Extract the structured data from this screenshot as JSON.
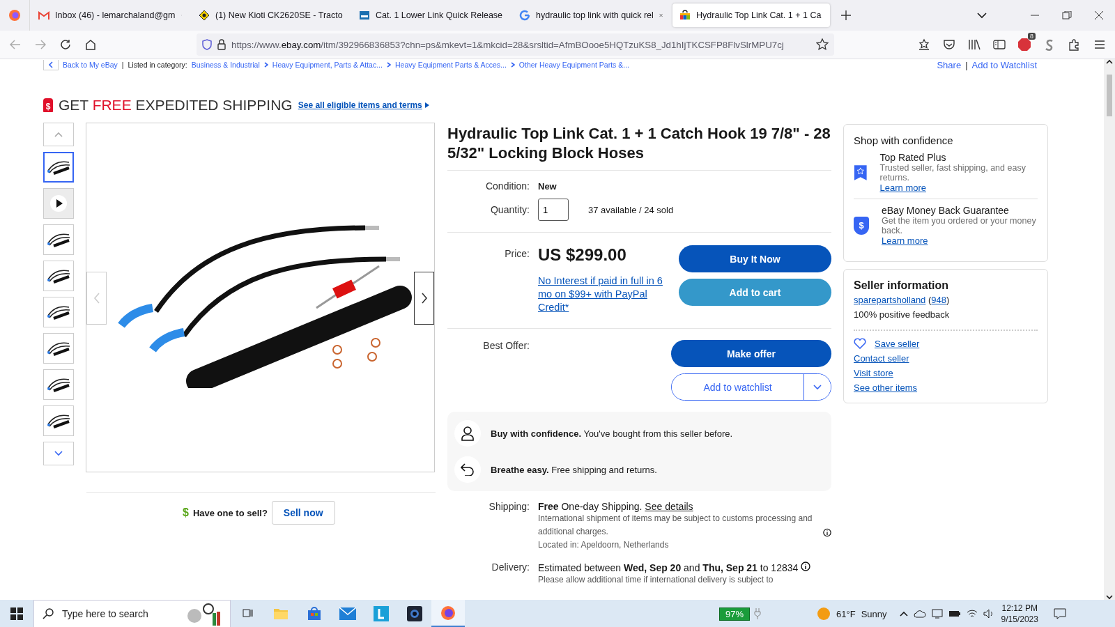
{
  "browser": {
    "tabs": [
      {
        "kind": "mail",
        "title": "Inbox (46) - lemarchaland@gm",
        "selected": false
      },
      {
        "kind": "sign",
        "title": "(1) New Kioti CK2620SE - Tracto",
        "selected": false
      },
      {
        "kind": "store",
        "title": "Cat. 1 Lower Link Quick Release",
        "selected": false
      },
      {
        "kind": "google",
        "title": "hydraulic top link with quick rel",
        "selected": false
      },
      {
        "kind": "bag",
        "title": "Hydraulic Top Link Cat. 1 + 1 Ca",
        "selected": true
      }
    ],
    "url": "https://www.ebay.com/itm/392966836853?chn=ps&mkevt=1&mkcid=28&srsltid=AfmBOooe5HQTzuKS8_Jd1hIjTKCSFP8FlvSlrMPU7cj",
    "adblock_count": "8"
  },
  "breadcrumb": {
    "back": "Back to My eBay",
    "label": "Listed in category:",
    "separator": "|",
    "crumbs": [
      "Business & Industrial",
      "Heavy Equipment, Parts & Attac...",
      "Heavy Equipment Parts & Acces...",
      "Other Heavy Equipment Parts &..."
    ],
    "share": "Share",
    "watch": "Add to Watchlist"
  },
  "banner": {
    "symbol": "$",
    "parts": [
      {
        "text": "GET ",
        "highlight": false
      },
      {
        "text": "FREE",
        "highlight": true
      },
      {
        "text": " EXPEDITED SHIPPING",
        "highlight": false
      }
    ],
    "link": "See all eligible items and terms"
  },
  "gallery": {
    "thumbnails": [
      {
        "kind": "photo",
        "selected": true
      },
      {
        "kind": "video",
        "selected": false
      },
      {
        "kind": "photo",
        "selected": false
      },
      {
        "kind": "photo",
        "selected": false
      },
      {
        "kind": "photo",
        "selected": false
      },
      {
        "kind": "photo",
        "selected": false
      },
      {
        "kind": "photo",
        "selected": false
      },
      {
        "kind": "photo",
        "selected": false
      }
    ]
  },
  "sell": {
    "symbol": "$",
    "prompt": "Have one to sell?",
    "button": "Sell now"
  },
  "item": {
    "title": "Hydraulic Top Link Cat. 1 + 1 Catch Hook 19 7/8\" - 28 5/32\" Locking Block Hoses",
    "condition_label": "Condition:",
    "condition": "New",
    "quantity_label": "Quantity:",
    "quantity": "1",
    "availability": "37 available / 24 sold",
    "price_label": "Price:",
    "price": "US $299.00",
    "financing": "No Interest if paid in full in 6 mo on $99+ with PayPal Credit*",
    "buy_now": "Buy It Now",
    "add_to_cart": "Add to cart",
    "best_offer_label": "Best Offer:",
    "make_offer": "Make offer",
    "watchlist": "Add to watchlist",
    "assurances": [
      {
        "kind": "person",
        "text": "**Buy with confidence.** You've bought from this seller before."
      },
      {
        "kind": "return",
        "text": "**Breathe easy.** Free shipping and returns."
      }
    ],
    "shipping_label": "Shipping:",
    "shipping": "**Free** One-day Shipping.",
    "shipping_link": "See details",
    "shipping_note": "International shipment of items may be subject to customs processing and additional charges.",
    "location": "Located in: Apeldoorn, Netherlands",
    "delivery_label": "Delivery:",
    "delivery": "Estimated between **Wed, Sep 20** and **Thu, Sep 21** to 12834",
    "delivery_note": "Please allow additional time if international delivery is subject to"
  },
  "confidence": {
    "title": "Shop with confidence",
    "items": [
      {
        "kind": "ribbon",
        "title": "Top Rated Plus",
        "text": "Trusted seller, fast shipping, and easy returns.",
        "link": "Learn more"
      },
      {
        "kind": "shield",
        "symbol": "$",
        "title": "eBay Money Back Guarantee",
        "text": "Get the item you ordered or your money back.",
        "link": "Learn more"
      }
    ]
  },
  "seller": {
    "title": "Seller information",
    "name": "sparepartsholland",
    "score": "(948)",
    "feedback": "100% positive feedback",
    "links": [
      {
        "kind": "heart",
        "text": "Save seller"
      },
      {
        "kind": "plain",
        "text": "Contact seller"
      },
      {
        "kind": "plain",
        "text": "Visit store"
      },
      {
        "kind": "plain",
        "text": "See other items"
      }
    ]
  },
  "taskbar": {
    "search_placeholder": "Type here to search",
    "apps": [
      {
        "kind": "taskview",
        "selected": false
      },
      {
        "kind": "folder",
        "selected": false
      },
      {
        "kind": "store",
        "selected": false
      },
      {
        "kind": "mail",
        "selected": false
      },
      {
        "kind": "letter",
        "selected": false
      },
      {
        "kind": "camera",
        "selected": false
      },
      {
        "kind": "firefox",
        "selected": true
      }
    ],
    "battery": "97%",
    "temperature": "61°F",
    "weather": "Sunny",
    "time": "12:12 PM",
    "date": "9/15/2023"
  }
}
